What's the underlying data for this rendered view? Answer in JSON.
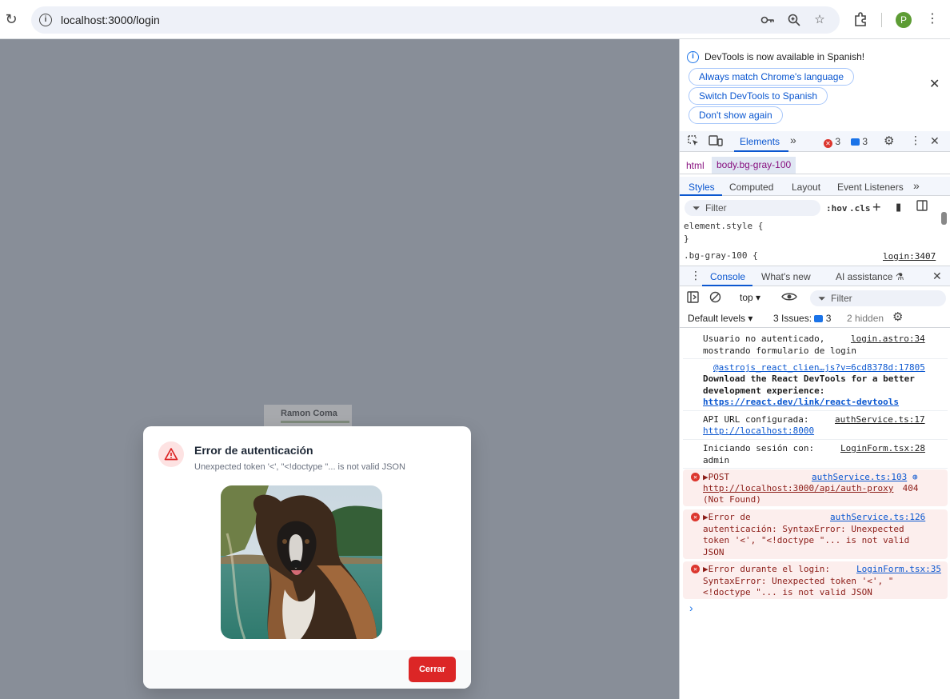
{
  "browser": {
    "url": "localhost:3000/login",
    "avatar_letter": "P",
    "icons": [
      "reload-icon",
      "site-info-icon",
      "key-icon",
      "zoom-icon",
      "star-icon",
      "extensions-icon",
      "menu-icon"
    ]
  },
  "page": {
    "bg_logo_text": "Ramon Coma",
    "modal": {
      "title": "Error de autenticación",
      "message": "Unexpected token '<', \"<!doctype \"... is not valid JSON",
      "close_label": "Cerrar",
      "accent": "#dc2626"
    }
  },
  "devtools": {
    "banner": {
      "text": "DevTools is now available in Spanish!",
      "btn1": "Always match Chrome's language",
      "btn2": "Switch DevTools to Spanish",
      "btn3": "Don't show again"
    },
    "main_tabs": {
      "elements": "Elements",
      "errors": "3",
      "messages": "3"
    },
    "breadcrumbs": {
      "html": "html",
      "body": "body.bg-gray-100"
    },
    "styles_tabs": {
      "styles": "Styles",
      "computed": "Computed",
      "layout": "Layout",
      "event_listeners": "Event Listeners"
    },
    "styles": {
      "filter_placeholder": "Filter",
      "hov": ":hov",
      "cls": ".cls",
      "line1": "element.style {",
      "line2": "}",
      "line3": ".bg-gray-100 {",
      "link": "login:3407"
    },
    "console_tabs": {
      "console": "Console",
      "whats_new": "What's new",
      "ai": "AI assistance"
    },
    "console_bar": {
      "context": "top",
      "filter_placeholder": "Filter",
      "levels": "Default levels",
      "issues_label": "3 Issues:",
      "issues_count": "3",
      "hidden": "2 hidden"
    },
    "logs": [
      {
        "text": "Usuario no autenticado,\nmostrando formulario de login",
        "src": "login.astro:34"
      },
      {
        "src": "@astrojs_react_clien…js?v=6cd8378d:17805",
        "text": "Download the React DevTools for a better\ndevelopment experience:",
        "link": "https://react.dev/link/react-devtools"
      },
      {
        "text": "API URL configurada:",
        "src": "authService.ts:17",
        "link": "http://localhost:8000"
      },
      {
        "text": "Iniciando sesión con:\nadmin",
        "src": "LoginForm.tsx:28"
      },
      {
        "text": "▶POST",
        "src": "authService.ts:103",
        "link": "http://localhost:3000/api/auth-proxy",
        "after": " 404",
        "tail": "(Not Found)"
      },
      {
        "text": "▶Error de\nautenticación: SyntaxError: Unexpected\ntoken '<', \"<!doctype \"... is not valid\nJSON",
        "src": "authService.ts:126"
      },
      {
        "text": "▶Error durante el login:\nSyntaxError: Unexpected token '<', \"\n<!doctype \"... is not valid JSON",
        "src": "LoginForm.tsx:35"
      }
    ],
    "prompt": "›"
  }
}
